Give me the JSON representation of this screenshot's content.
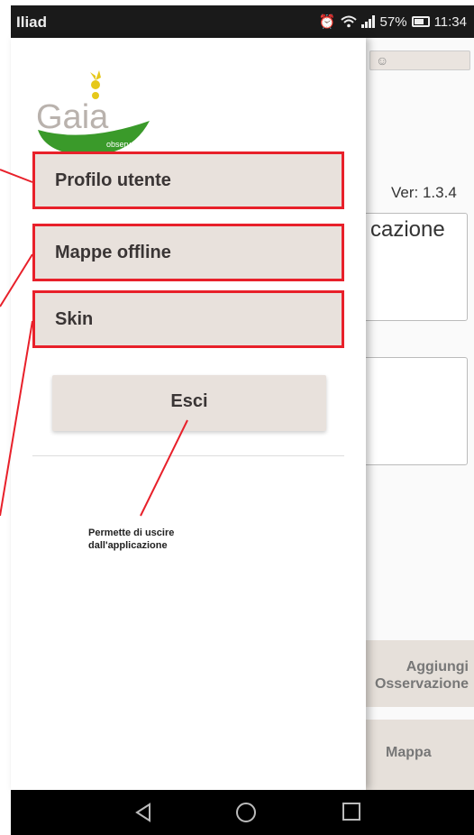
{
  "status_bar": {
    "carrier": "Iliad",
    "battery": "57%",
    "time": "11:34"
  },
  "background_app": {
    "version": "Ver: 1.3.4",
    "box_text": "cazione",
    "add_button": "Aggiungi\nOsservazione",
    "map_button": "Mappa"
  },
  "drawer": {
    "logo_text": "Gaia",
    "logo_subtext": "observer",
    "items": [
      {
        "label": "Profilo utente"
      },
      {
        "label": "Mappe offline"
      },
      {
        "label": "Skin"
      }
    ],
    "exit_label": "Esci"
  },
  "annotation": {
    "text": "Permette di uscire\ndall'applicazione"
  },
  "colors": {
    "highlight": "#e8202a",
    "menu_bg": "#e8e1dc",
    "logo_green": "#3a9a2a"
  }
}
